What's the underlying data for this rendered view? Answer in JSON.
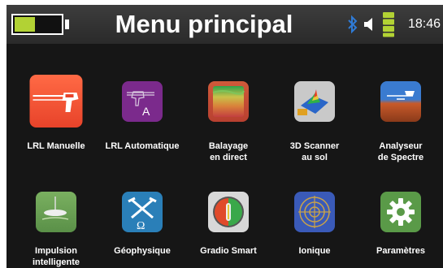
{
  "header": {
    "title": "Menu principal",
    "time": "18:46",
    "battery_level": 0.45,
    "status_icons": [
      "battery-icon",
      "bluetooth-icon",
      "speaker-icon",
      "signal-icon"
    ]
  },
  "menu": [
    {
      "label": "LRL Manuelle",
      "icon": "lrl-manual-icon"
    },
    {
      "label": "LRL Automatique",
      "icon": "lrl-automatic-icon"
    },
    {
      "label": "Balayage en direct",
      "icon": "live-scan-icon"
    },
    {
      "label": "3D Scanner au sol",
      "icon": "ground-scanner-3d-icon"
    },
    {
      "label": "Analyseur de Spectre",
      "icon": "spectrum-analyzer-icon"
    },
    {
      "label": "Impulsion intelligente",
      "icon": "smart-pulse-icon"
    },
    {
      "label": "Géophysique",
      "icon": "geophysics-icon"
    },
    {
      "label": "Gradio Smart",
      "icon": "gradio-smart-icon"
    },
    {
      "label": "Ionique",
      "icon": "ionic-icon"
    },
    {
      "label": "Paramètres",
      "icon": "settings-icon"
    }
  ],
  "colors": {
    "background": "#161616",
    "header": "#333333",
    "battery": "#b2d234",
    "bluetooth": "#2f7bd6"
  }
}
